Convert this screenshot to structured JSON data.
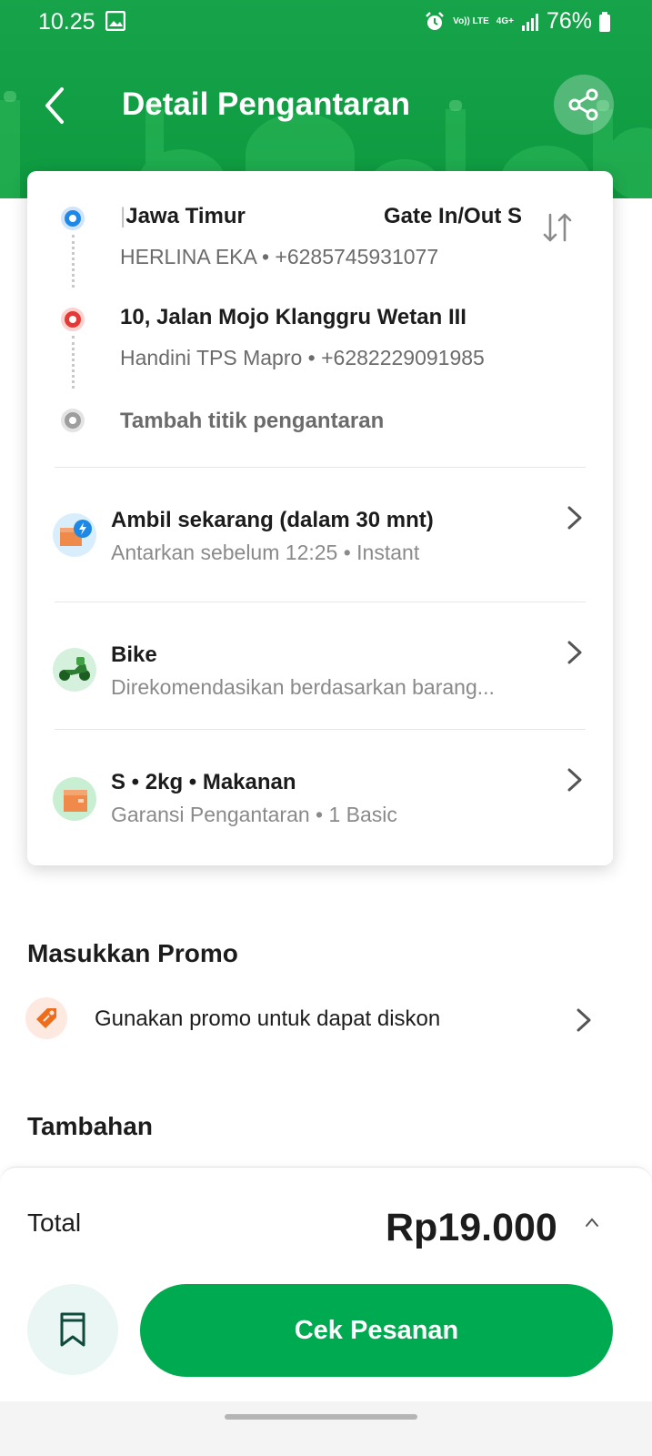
{
  "status_bar": {
    "time": "10.25",
    "network_volte": "Vo)) LTE",
    "network_4g": "4G+",
    "battery": "76%"
  },
  "header": {
    "title": "Detail Pengantaran",
    "back_icon": "arrow-left-icon",
    "share_icon": "share-icon"
  },
  "route": {
    "pickup": {
      "title_left": "Jawa Timur",
      "title_right": "Gate In/Out S",
      "contact": "HERLINA EKA • +6285745931077"
    },
    "dropoff": {
      "title": "10, Jalan Mojo Klanggru Wetan III",
      "contact": "Handini TPS Mapro • +6282229091985"
    },
    "add_stop": "Tambah titik pengantaran"
  },
  "options": [
    {
      "title": "Ambil sekarang (dalam 30 mnt)",
      "subtitle": "Antarkan sebelum 12:25 • Instant",
      "icon": "instant-box-icon"
    },
    {
      "title": "Bike",
      "subtitle": "Direkomendasikan berdasarkan barang...",
      "icon": "motorbike-icon"
    },
    {
      "title": "S • 2kg • Makanan",
      "subtitle": "Garansi Pengantaran • 1 Basic",
      "icon": "package-icon"
    }
  ],
  "promo": {
    "heading": "Masukkan Promo",
    "text": "Gunakan promo untuk dapat diskon",
    "icon": "promo-tag-icon"
  },
  "extras": {
    "heading": "Tambahan"
  },
  "footer": {
    "total_label": "Total",
    "total_value": "Rp19.000",
    "button_label": "Cek Pesanan",
    "accent_color": "#00aa50"
  }
}
